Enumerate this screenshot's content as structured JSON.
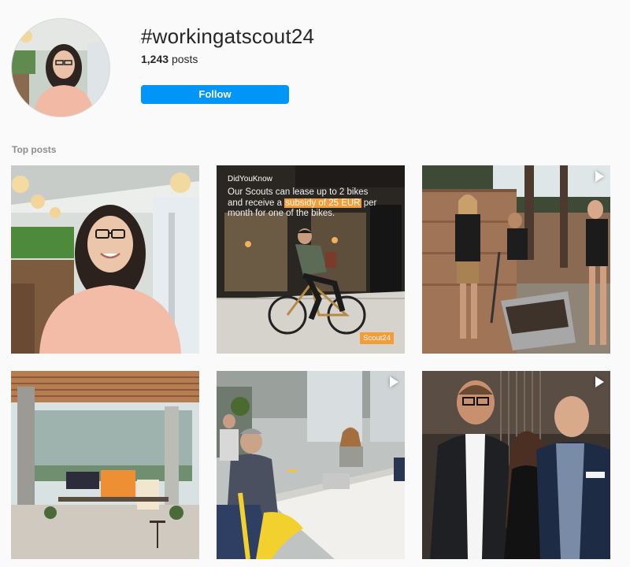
{
  "profile": {
    "hashtag": "#workingatscout24",
    "posts_count": "1,243",
    "posts_label": "posts",
    "follow_label": "Follow"
  },
  "top_posts": {
    "title": "Top posts",
    "items": [
      {
        "type": "image"
      },
      {
        "type": "image",
        "tag": "DidYouKnow",
        "text_before": "Our Scouts can lease up to 2 bikes and receive a ",
        "text_highlight": "subsidy of 25 EUR",
        "text_after": " per month for one of the bikes.",
        "brand": "Scout24"
      },
      {
        "type": "video"
      },
      {
        "type": "image"
      },
      {
        "type": "video"
      },
      {
        "type": "video"
      }
    ]
  },
  "colors": {
    "follow_button": "#0095f6",
    "background": "#fafafa",
    "accent_orange": "#f39c38"
  }
}
